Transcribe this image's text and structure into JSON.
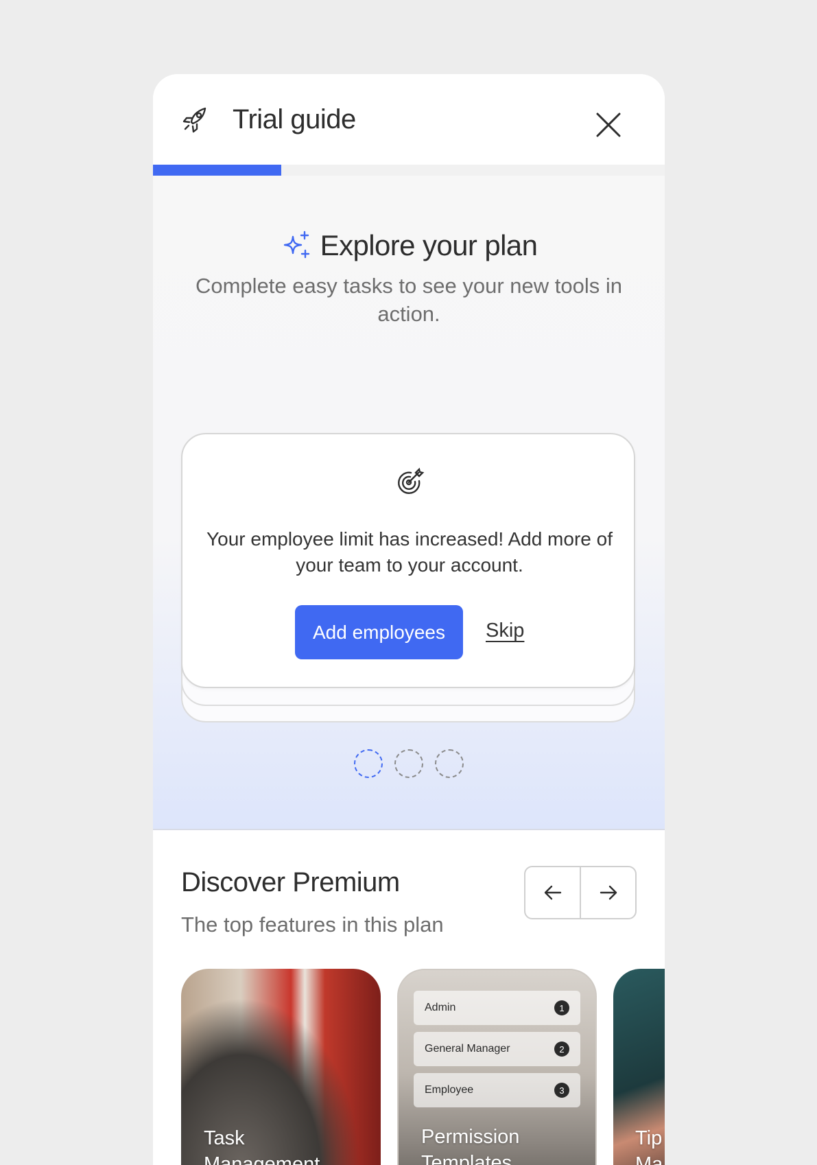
{
  "header": {
    "title": "Trial guide",
    "progress": 0.25,
    "icons": {
      "logo": "rocket-icon",
      "close": "close-icon"
    }
  },
  "explore": {
    "title": "Explore your plan",
    "subtitle": "Complete easy tasks to see your new tools in action.",
    "icon": "sparkle-icon",
    "card": {
      "icon": "target-icon",
      "text": "Your employee limit has increased! Add more of your team to your account.",
      "primary_label": "Add employees",
      "skip_label": "Skip"
    },
    "steps": {
      "total": 3,
      "active": 1
    }
  },
  "discover": {
    "title": "Discover Premium",
    "subtitle": "The top features in this plan",
    "features": [
      {
        "label_line1": "Task",
        "label_line2": "Management"
      },
      {
        "label_line1": "Permission",
        "label_line2": "Templates",
        "roles": [
          {
            "name": "Admin",
            "rank": "1"
          },
          {
            "name": "General Manager",
            "rank": "2"
          },
          {
            "name": "Employee",
            "rank": "3"
          }
        ]
      },
      {
        "label_line1": "Tip",
        "label_line2": "Ma"
      }
    ]
  },
  "colors": {
    "accent": "#4069f2",
    "text": "#2d2d2d",
    "muted": "#6d6d6d",
    "background": "#ededed"
  }
}
